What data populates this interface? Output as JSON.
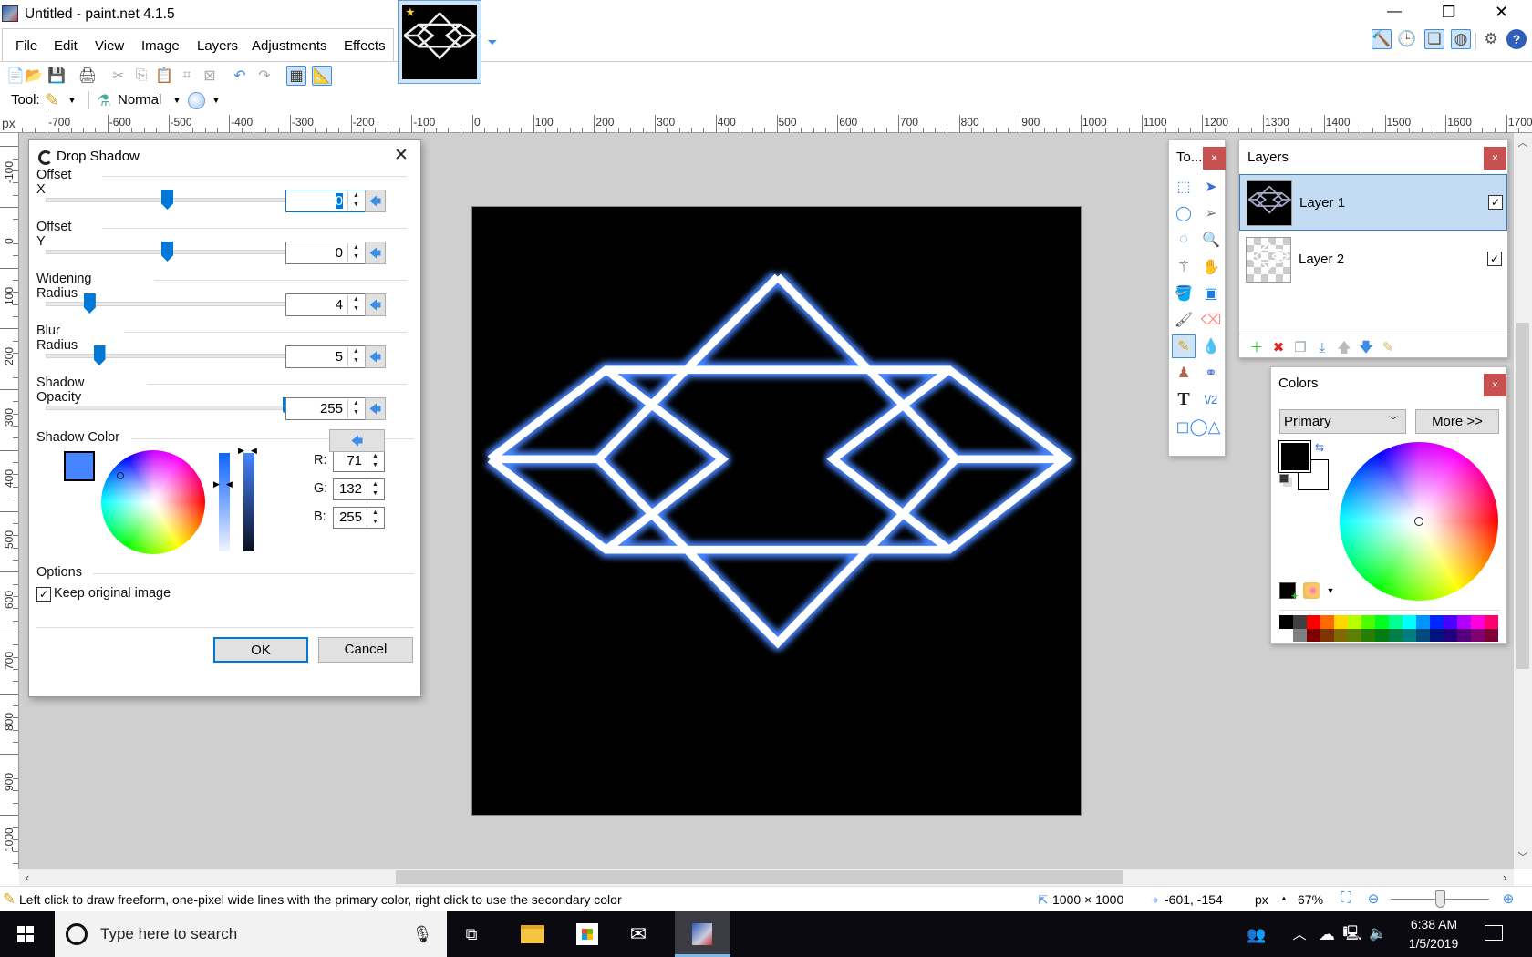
{
  "window": {
    "title": "Untitled - paint.net 4.1.5",
    "minimize": "—",
    "restore": "❐",
    "close": "✕"
  },
  "menu": [
    "File",
    "Edit",
    "View",
    "Image",
    "Layers",
    "Adjustments",
    "Effects"
  ],
  "toolbar_icons": [
    "new-icon",
    "open-icon",
    "save-icon",
    "print-icon",
    "cut-icon",
    "copy-icon",
    "paste-icon",
    "crop-icon",
    "deselect-icon",
    "undo-icon",
    "redo-icon",
    "grid-icon",
    "rulers-icon"
  ],
  "toolbar_right_icons": [
    "tools-icon",
    "history-icon",
    "layers-icon",
    "colors-icon",
    "settings-icon",
    "help-icon"
  ],
  "toolrow": {
    "tool_label": "Tool:",
    "blend_mode": "Normal"
  },
  "ruler": {
    "unit": "px",
    "h_labels": [
      -700,
      -600,
      -500,
      -400,
      -300,
      -200,
      -100,
      0,
      100,
      200,
      300,
      400,
      500,
      600,
      700,
      800,
      900,
      1000,
      1100,
      1200,
      1300,
      1400,
      1500,
      1600,
      1700
    ],
    "v_labels": [
      -100,
      0,
      100,
      200,
      300,
      400,
      500,
      600,
      700,
      800,
      900,
      1000
    ]
  },
  "dialog": {
    "title": "Drop Shadow",
    "sliders": [
      {
        "label": "Offset X",
        "value": "0",
        "fraction": 0.5
      },
      {
        "label": "Offset Y",
        "value": "0",
        "fraction": 0.5
      },
      {
        "label": "Widening Radius",
        "value": "4",
        "fraction": 0.18
      },
      {
        "label": "Blur Radius",
        "value": "5",
        "fraction": 0.22
      },
      {
        "label": "Shadow Opacity",
        "value": "255",
        "fraction": 1.0
      }
    ],
    "shadow_color_label": "Shadow Color",
    "shadow_color": "#4784ff",
    "rgb": [
      {
        "label": "R:",
        "value": "71"
      },
      {
        "label": "G:",
        "value": "132"
      },
      {
        "label": "B:",
        "value": "255"
      }
    ],
    "options_label": "Options",
    "keep_original_label": "Keep original image",
    "keep_original_checked": true,
    "ok": "OK",
    "cancel": "Cancel"
  },
  "tools_panel": {
    "title": "To...",
    "close": "×",
    "active_tool": "pencil"
  },
  "layers_panel": {
    "title": "Layers",
    "close": "×",
    "layers": [
      {
        "name": "Layer 1",
        "visible": true,
        "selected": true
      },
      {
        "name": "Layer 2",
        "visible": true,
        "selected": false
      }
    ]
  },
  "colors_panel": {
    "title": "Colors",
    "close": "×",
    "mode": "Primary",
    "more": "More >>",
    "primary": "#000000",
    "secondary": "#ffffff",
    "palette_top": [
      "#000000",
      "#404040",
      "#ff0000",
      "#ff6a00",
      "#ffd800",
      "#b6ff00",
      "#4cff00",
      "#00ff21",
      "#00ff90",
      "#00ffff",
      "#0094ff",
      "#0026ff",
      "#4800ff",
      "#b200ff",
      "#ff00dc",
      "#ff006e"
    ],
    "palette_bottom": [
      "#ffffff",
      "#808080",
      "#7f0000",
      "#7f3300",
      "#7f6a00",
      "#5b7f00",
      "#267f00",
      "#007f0e",
      "#007f46",
      "#007f7f",
      "#004a7f",
      "#00137f",
      "#21007f",
      "#57007f",
      "#7f006e",
      "#7f0037"
    ]
  },
  "status": {
    "hint": "Left click to draw freeform, one-pixel wide lines with the primary color, right click to use the secondary color",
    "image_size": "1000 × 1000",
    "cursor": "-601, -154",
    "unit": "px",
    "zoom": "67%",
    "zoom_slider_fraction": 0.5
  },
  "taskbar": {
    "search_placeholder": "Type here to search",
    "time": "6:38 AM",
    "date": "1/5/2019"
  }
}
